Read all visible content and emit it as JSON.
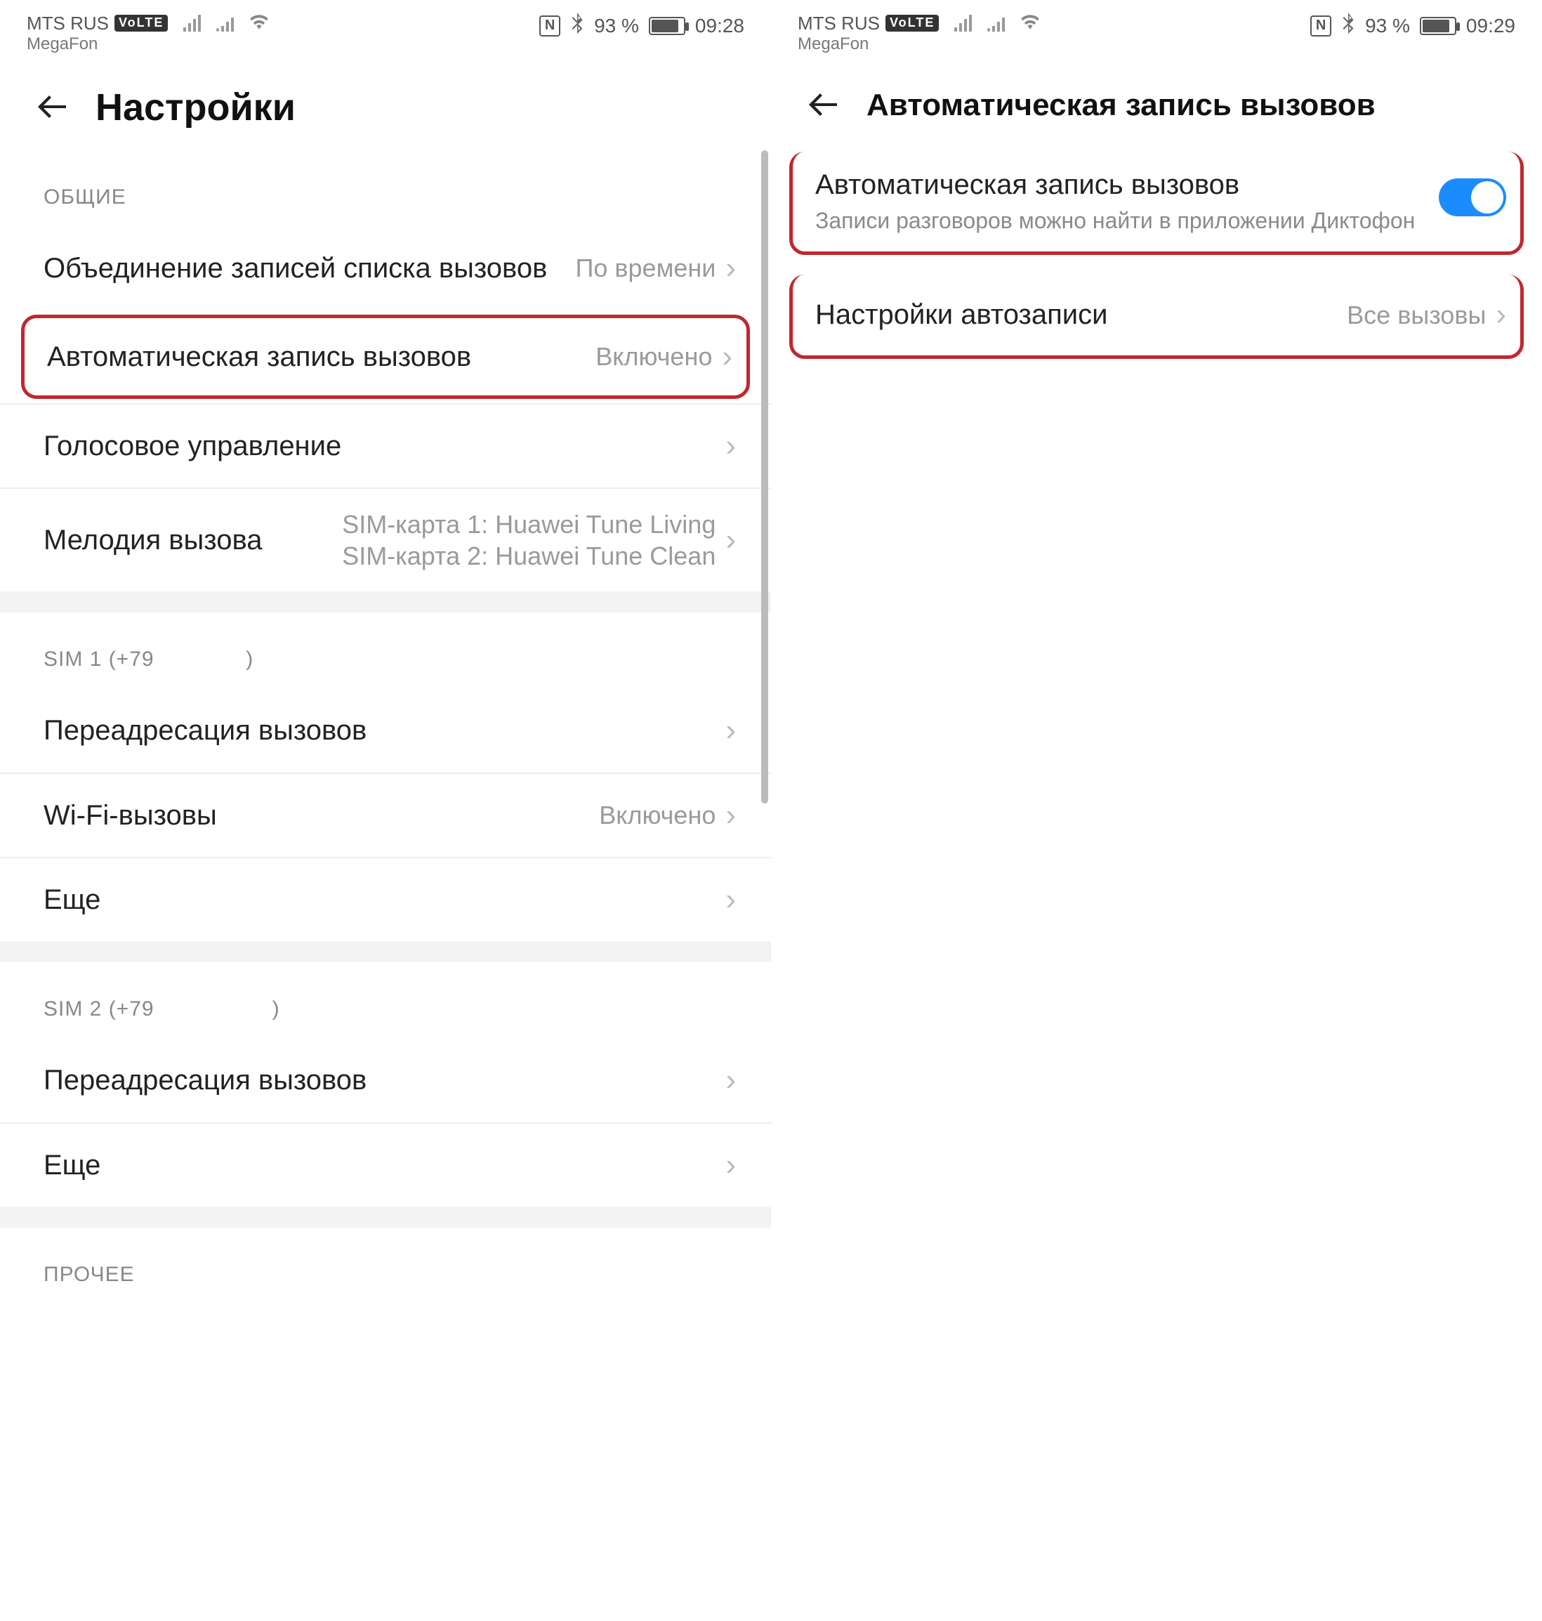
{
  "left": {
    "status": {
      "carrier1": "MTS RUS",
      "volte": "VoLTE",
      "carrier2": "MegaFon",
      "nfc": "N",
      "battery_pct": "93 %",
      "time": "09:28"
    },
    "header_title": "Настройки",
    "section_general": "ОБЩИЕ",
    "rows": {
      "merge": {
        "title": "Объединение записей списка вызовов",
        "value": "По времени"
      },
      "auto_record": {
        "title": "Автоматическая запись вызовов",
        "value": "Включено"
      },
      "voice_control": {
        "title": "Голосовое управление"
      },
      "ringtone": {
        "title": "Мелодия вызова",
        "value_line1": "SIM-карта 1: Huawei Tune Living",
        "value_line2": "SIM-карта 2: Huawei Tune Clean"
      }
    },
    "section_sim1": "SIM 1 (+79",
    "sim1_tail": ")",
    "sim1_rows": {
      "forwarding": {
        "title": "Переадресация вызовов"
      },
      "wifi_calls": {
        "title": "Wi-Fi-вызовы",
        "value": "Включено"
      },
      "more": {
        "title": "Еще"
      }
    },
    "section_sim2": "SIM 2 (+79",
    "sim2_tail": ")",
    "sim2_rows": {
      "forwarding": {
        "title": "Переадресация вызовов"
      },
      "more": {
        "title": "Еще"
      }
    },
    "section_other": "ПРОЧЕЕ"
  },
  "right": {
    "status": {
      "carrier1": "MTS RUS",
      "volte": "VoLTE",
      "carrier2": "MegaFon",
      "nfc": "N",
      "battery_pct": "93 %",
      "time": "09:29"
    },
    "header_title": "Автоматическая запись вызовов",
    "rows": {
      "auto_record": {
        "title": "Автоматическая запись вызовов",
        "sub": "Записи разговоров можно найти в приложении Диктофон",
        "toggle": true
      },
      "auto_settings": {
        "title": "Настройки автозаписи",
        "value": "Все вызовы"
      }
    }
  }
}
